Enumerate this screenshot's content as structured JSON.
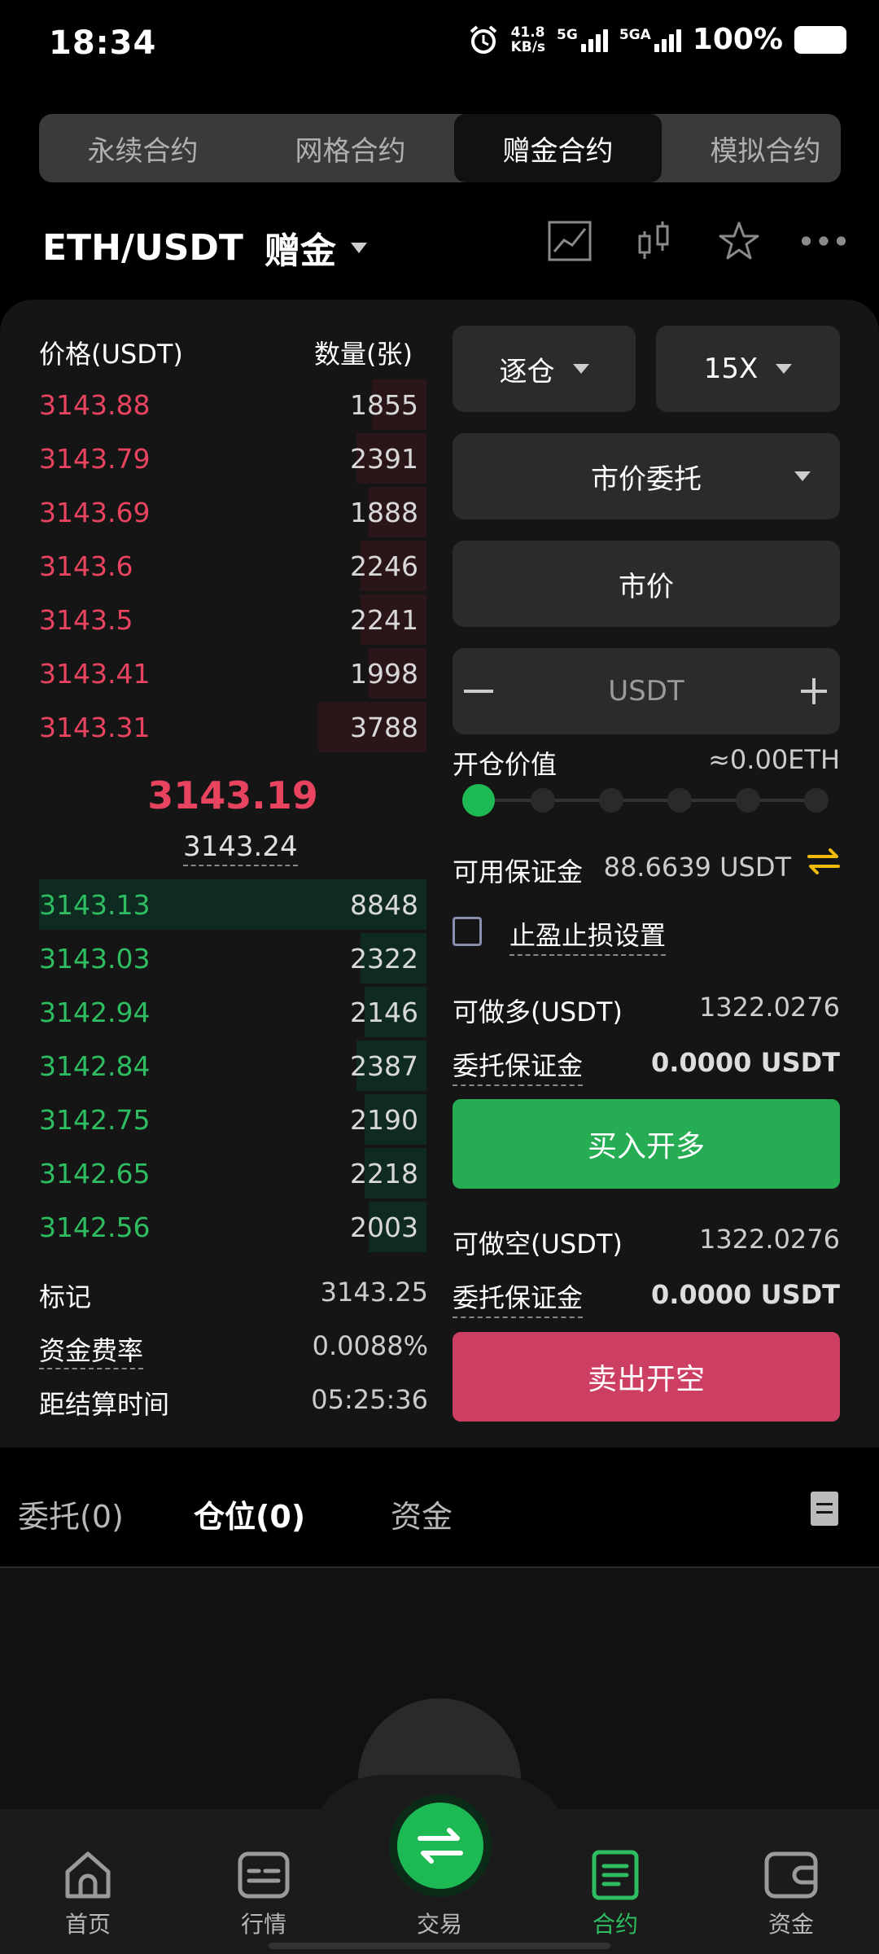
{
  "status_bar": {
    "time": "18:34",
    "net_speed_value": "41.8",
    "net_speed_unit": "KB/s",
    "sim1": "5G",
    "sim2": "5GA",
    "battery": "100%"
  },
  "contract_tabs": [
    {
      "label": "永续合约",
      "active": false
    },
    {
      "label": "网格合约",
      "active": false
    },
    {
      "label": "赠金合约",
      "active": true
    },
    {
      "label": "模拟合约",
      "active": false
    }
  ],
  "pair": {
    "symbol": "ETH/USDT",
    "tag": "赠金"
  },
  "order_book": {
    "price_header": "价格(USDT)",
    "qty_header": "数量(张)",
    "asks": [
      {
        "price": "3143.88",
        "qty": "1855",
        "depth": 0.14
      },
      {
        "price": "3143.79",
        "qty": "2391",
        "depth": 0.18
      },
      {
        "price": "3143.69",
        "qty": "1888",
        "depth": 0.15
      },
      {
        "price": "3143.6",
        "qty": "2246",
        "depth": 0.17
      },
      {
        "price": "3143.5",
        "qty": "2241",
        "depth": 0.17
      },
      {
        "price": "3143.41",
        "qty": "1998",
        "depth": 0.15
      },
      {
        "price": "3143.31",
        "qty": "3788",
        "depth": 0.28
      }
    ],
    "last_price": "3143.19",
    "mark_price": "3143.24",
    "bids": [
      {
        "price": "3143.13",
        "qty": "8848",
        "depth": 1.0
      },
      {
        "price": "3143.03",
        "qty": "2322",
        "depth": 0.17
      },
      {
        "price": "3142.94",
        "qty": "2146",
        "depth": 0.16
      },
      {
        "price": "3142.84",
        "qty": "2387",
        "depth": 0.18
      },
      {
        "price": "3142.75",
        "qty": "2190",
        "depth": 0.16
      },
      {
        "price": "3142.65",
        "qty": "2218",
        "depth": 0.16
      },
      {
        "price": "3142.56",
        "qty": "2003",
        "depth": 0.15
      }
    ]
  },
  "stats": {
    "mark_label": "标记",
    "mark_value": "3143.25",
    "funding_label": "资金费率",
    "funding_value": "0.0088%",
    "settle_label": "距结算时间",
    "settle_value": "05:25:36"
  },
  "order_form": {
    "margin_mode": "逐仓",
    "leverage": "15X",
    "order_type": "市价委托",
    "price_field": "市价",
    "amount_placeholder": "USDT",
    "open_value_label": "开仓价值",
    "open_value": "≈0.00ETH",
    "slider_value": 0,
    "available_label": "可用保证金",
    "available_value": "88.6639 USDT",
    "tpsl_label": "止盈止损设置",
    "long_label": "可做多(USDT)",
    "long_value": "1322.0276",
    "margin_label_1": "委托保证金",
    "margin_value_1": "0.0000 USDT",
    "buy_button": "买入开多",
    "short_label": "可做空(USDT)",
    "short_value": "1322.0276",
    "margin_label_2": "委托保证金",
    "margin_value_2": "0.0000 USDT",
    "sell_button": "卖出开空"
  },
  "bottom_tabs": {
    "orders": "委托(0)",
    "positions": "仓位(0)",
    "funds": "资金"
  },
  "nav": [
    {
      "label": "首页",
      "icon": "home-icon"
    },
    {
      "label": "行情",
      "icon": "market-icon"
    },
    {
      "label": "交易",
      "icon": "trade-icon"
    },
    {
      "label": "合约",
      "icon": "contract-icon",
      "active": true
    },
    {
      "label": "资金",
      "icon": "wallet-icon"
    }
  ],
  "colors": {
    "ask": "#e8435f",
    "bid": "#2ebd60",
    "buy_button": "#26ad54",
    "sell_button": "#cc3f63",
    "accent": "#1db954"
  }
}
